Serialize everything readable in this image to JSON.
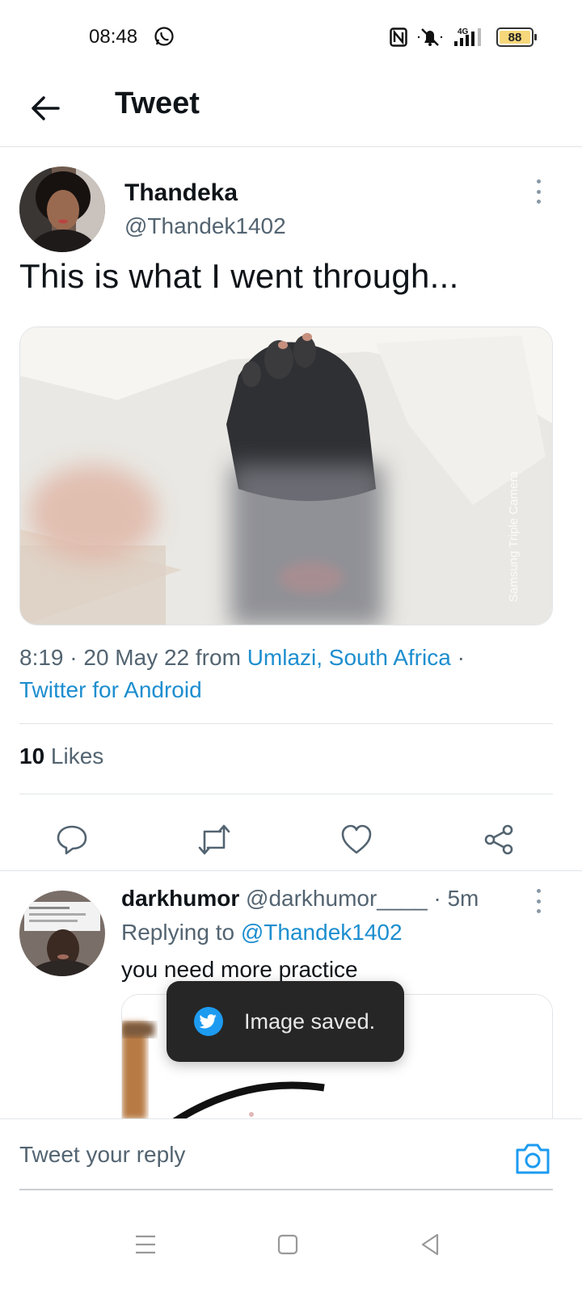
{
  "status_bar": {
    "time": "08:48",
    "network": "4G",
    "battery": "88",
    "icons": [
      "whatsapp-icon",
      "nfc-icon",
      "mute-icon",
      "signal-icon",
      "battery-icon"
    ]
  },
  "header": {
    "title": "Tweet",
    "back_icon": "arrow-left-icon"
  },
  "tweet": {
    "author_name": "Thandeka",
    "author_handle": "@Thandek1402",
    "text": "This is what I went through...",
    "time_date": "8:19 · 20 May 22",
    "from_word": " from ",
    "location": "Umlazi, South Africa",
    "meta_sep": " ·",
    "source": "Twitter for Android",
    "likes_count": "10",
    "likes_label": " Likes",
    "media_watermark": "Samsung Triple Camera"
  },
  "actions": [
    "reply-icon",
    "retweet-icon",
    "like-icon",
    "share-icon"
  ],
  "reply": {
    "name": "darkhumor",
    "handle": "@darkhumor____",
    "sep": " · ",
    "time": "5m",
    "replying_prefix": "Replying to ",
    "replying_to": "@Thandek1402",
    "text": "you need more practice"
  },
  "toast": {
    "text": "Image saved."
  },
  "compose": {
    "placeholder": "Tweet your reply"
  },
  "colors": {
    "link": "#1d8ecf",
    "secondary_text": "#536471",
    "toast_bg": "#262626",
    "twitter_blue": "#1d9bf0"
  }
}
